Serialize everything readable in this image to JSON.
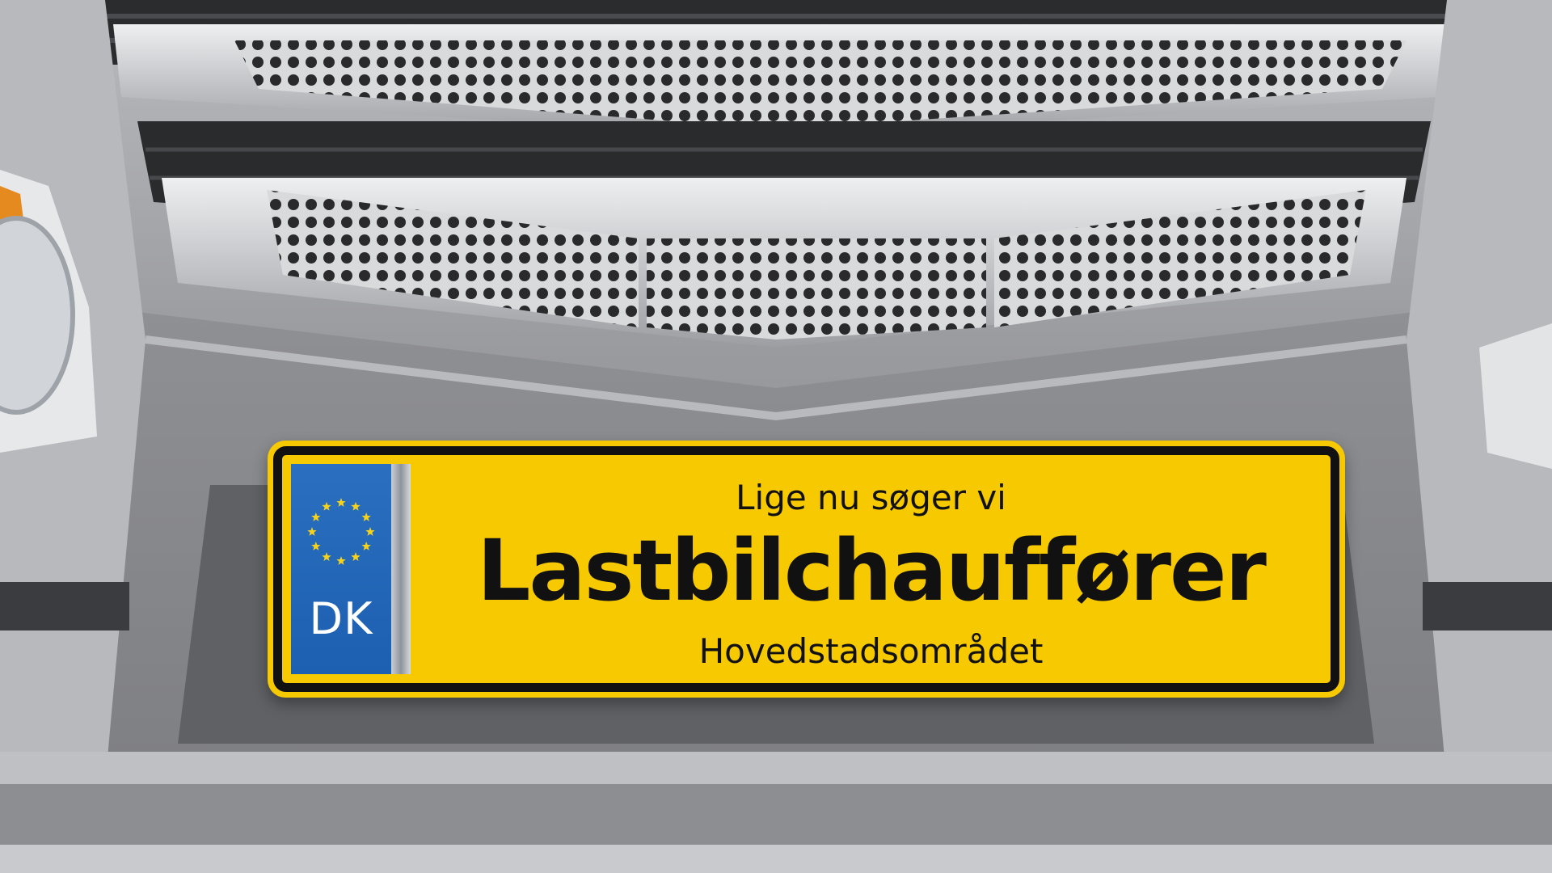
{
  "plate": {
    "country_code": "DK",
    "line_top": "Lige nu søger vi",
    "line_main": "Lastbilchauffører",
    "line_bottom": "Hovedstadsområdet"
  },
  "colors": {
    "plate_yellow": "#f7c900",
    "plate_border": "#111111",
    "eu_blue": "#1d5fb0",
    "eu_star": "#f7d21a",
    "truck_silver": "#a3a4a8"
  },
  "icons": [
    "eu-stars-icon"
  ]
}
